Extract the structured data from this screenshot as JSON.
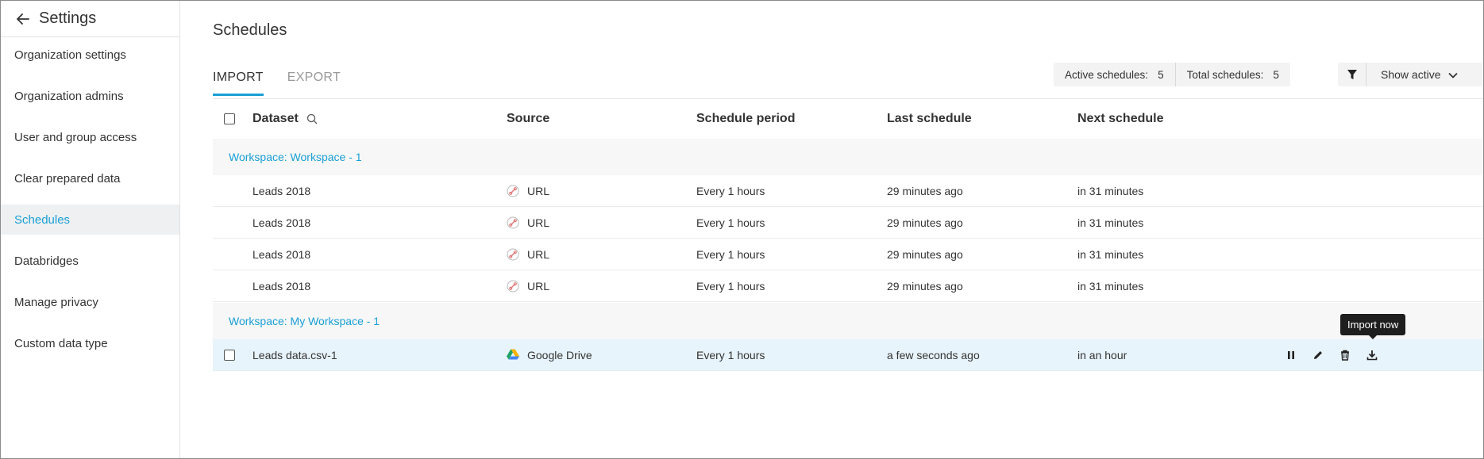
{
  "sidebar": {
    "title": "Settings",
    "back_icon": "arrow-left-icon",
    "items": [
      {
        "label": "Organization settings",
        "active": false
      },
      {
        "label": "Organization admins",
        "active": false
      },
      {
        "label": "User and group access",
        "active": false
      },
      {
        "label": "Clear prepared data",
        "active": false
      },
      {
        "label": "Schedules",
        "active": true
      },
      {
        "label": "Databridges",
        "active": false
      },
      {
        "label": "Manage privacy",
        "active": false
      },
      {
        "label": "Custom data type",
        "active": false
      }
    ]
  },
  "main": {
    "title": "Schedules",
    "tabs": [
      {
        "label": "IMPORT",
        "active": true
      },
      {
        "label": "EXPORT",
        "active": false
      }
    ],
    "stats": {
      "active_label": "Active schedules:",
      "active_value": "5",
      "total_label": "Total schedules:",
      "total_value": "5"
    },
    "filter": {
      "icon": "funnel-icon",
      "show_label": "Show active",
      "chevron": "chevron-down-icon"
    },
    "table": {
      "headers": {
        "dataset": "Dataset",
        "source": "Source",
        "period": "Schedule period",
        "last": "Last schedule",
        "next": "Next schedule"
      },
      "groups": [
        {
          "label": "Workspace: Workspace - 1",
          "rows": [
            {
              "dataset": "Leads 2018",
              "source": "URL",
              "source_icon": "url-link-icon",
              "period": "Every 1 hours",
              "last": "29 minutes ago",
              "next": "in 31 minutes"
            },
            {
              "dataset": "Leads 2018",
              "source": "URL",
              "source_icon": "url-link-icon",
              "period": "Every 1 hours",
              "last": "29 minutes ago",
              "next": "in 31 minutes"
            },
            {
              "dataset": "Leads 2018",
              "source": "URL",
              "source_icon": "url-link-icon",
              "period": "Every 1 hours",
              "last": "29 minutes ago",
              "next": "in 31 minutes"
            },
            {
              "dataset": "Leads 2018",
              "source": "URL",
              "source_icon": "url-link-icon",
              "period": "Every 1 hours",
              "last": "29 minutes ago",
              "next": "in 31 minutes"
            }
          ]
        },
        {
          "label": "Workspace: My Workspace - 1",
          "rows": [
            {
              "dataset": "Leads data.csv-1",
              "source": "Google Drive",
              "source_icon": "google-drive-icon",
              "period": "Every 1 hours",
              "last": "a few seconds ago",
              "next": "in an hour"
            }
          ]
        }
      ]
    },
    "row_actions": {
      "icons": [
        "pause-icon",
        "pencil-icon",
        "trash-icon",
        "download-icon"
      ],
      "tooltip": "Import now"
    }
  },
  "colors": {
    "accent": "#1a9fd4",
    "selected_row": "#e8f4fb",
    "group_bg": "#f7f7f7",
    "tooltip_bg": "#1e1e1e"
  }
}
